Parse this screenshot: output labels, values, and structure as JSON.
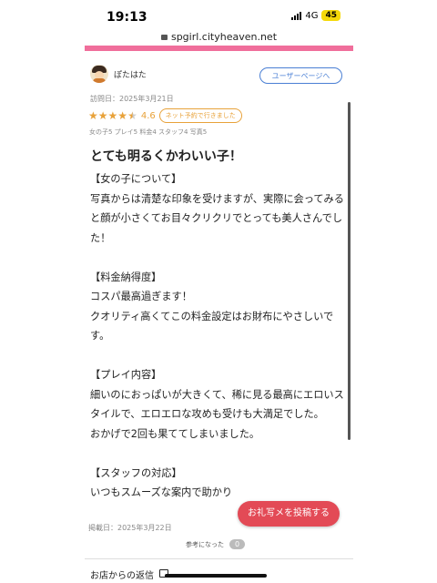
{
  "status_bar": {
    "time": "19:13",
    "network": "4G",
    "battery": "45"
  },
  "browser": {
    "url": "spgirl.cityheaven.net"
  },
  "colors": {
    "accent_pink": "#f06e9b",
    "star": "#e8a23a",
    "button_blue": "#4a7fd4",
    "post_red": "#e34a56"
  },
  "review": {
    "username": "ぽたはた",
    "user_page_button": "ユーザーページへ",
    "visit_date": "訪問日：2025年3月21日",
    "rating": 4.6,
    "rating_text": "4.6",
    "net_reservation_badge": "ネット予約で行きました",
    "subscores": "女の子5 プレイ5 料金4 スタッフ4 写真5",
    "title": "とても明るくかわいい子！",
    "body": "【女の子について】\n写真からは清楚な印象を受けますが、実際に会ってみると顔が小さくてお目々クリクリでとっても美人さんでした！\n\n【料金納得度】\nコスパ最高過ぎます！\nクオリティ高くてこの料金設定はお財布にやさしいです。\n\n【プレイ内容】\n細いのにおっぱいが大きくて、稀に見る最高にエロいスタイルで、エロエロな攻めも受けも大満足でした。\nおかげで2回も果ててしまいました。\n\n【スタッフの対応】\nいつもスムーズな案内で助かり",
    "post_date": "掲載日：2025年3月22日",
    "helpful_label": "参考になった",
    "helpful_count": "0"
  },
  "post_photo_button": "お礼写メを投稿する",
  "shop_reply_label": "お店からの返信"
}
